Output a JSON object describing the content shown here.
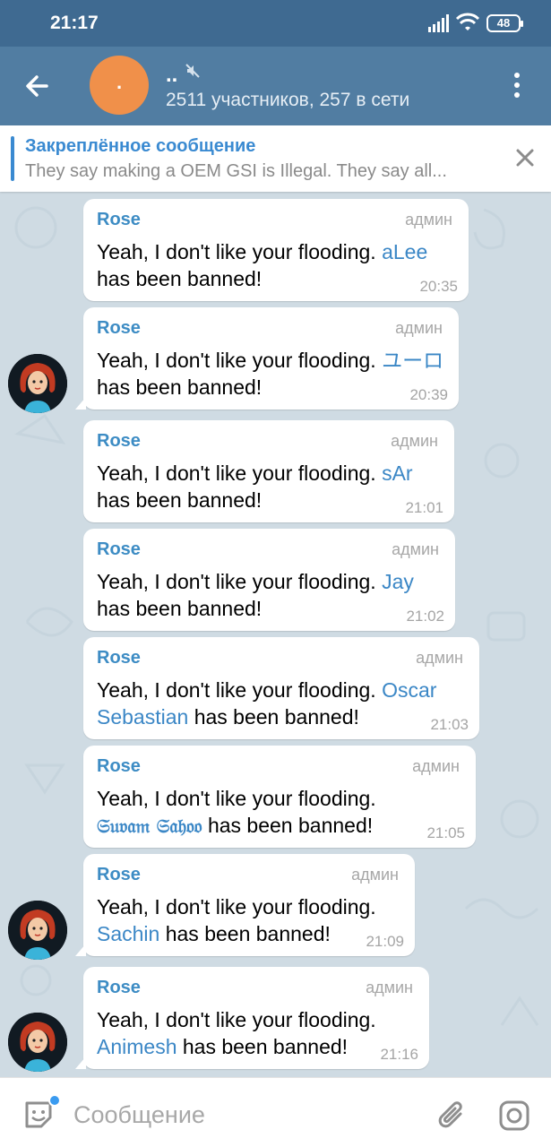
{
  "status_bar": {
    "time": "21:17",
    "battery": "48"
  },
  "header": {
    "avatar_initial": ".",
    "title": "..",
    "subtitle": "2511 участников, 257 в сети",
    "back_icon": "arrow-left-icon",
    "menu_icon": "more-vertical-icon"
  },
  "pinned": {
    "title": "Закреплённое сообщение",
    "text": "They say making a OEM GSI is Illegal. They say all..."
  },
  "messages": [
    {
      "sender": "Rose",
      "role": "админ",
      "text": "Yeah, I don't like your flooding.",
      "mention": "aLee",
      "suffix": "has been banned!",
      "time": "20:35"
    },
    {
      "sender": "Rose",
      "role": "админ",
      "text": "Yeah, I don't like your flooding.",
      "mention": "ユーロ",
      "suffix": "has been banned!",
      "time": "20:39"
    },
    {
      "sender": "Rose",
      "role": "админ",
      "text": "Yeah, I don't like your flooding.",
      "mention": "sAr",
      "suffix": "has been banned!",
      "time": "21:01"
    },
    {
      "sender": "Rose",
      "role": "админ",
      "text": "Yeah, I don't like your flooding.",
      "mention": "Jay",
      "suffix": "has been banned!",
      "time": "21:02"
    },
    {
      "sender": "Rose",
      "role": "админ",
      "text": "Yeah, I don't like your flooding.",
      "mention": "Oscar Sebastian",
      "suffix": "has been banned!",
      "time": "21:03"
    },
    {
      "sender": "Rose",
      "role": "админ",
      "text": "Yeah, I don't like your flooding.",
      "mention": "𝔖𝔲𝔳𝔞𝔪 𝔖𝔞𝔥𝔬𝔬",
      "suffix": "has been banned!",
      "time": "21:05"
    },
    {
      "sender": "Rose",
      "role": "админ",
      "text": "Yeah, I don't like your flooding.",
      "mention": "Sachin",
      "suffix": "has been banned!",
      "time": "21:09"
    },
    {
      "sender": "Rose",
      "role": "админ",
      "text": "Yeah, I don't like your flooding.",
      "mention": "Animesh",
      "suffix": "has been banned!",
      "time": "21:16"
    }
  ],
  "input": {
    "placeholder": "Сообщение"
  },
  "colors": {
    "header": "#517da2",
    "status_bar": "#3f6a91",
    "accent": "#3d8cc4",
    "chat_bg": "#cfdbe3",
    "avatar": "#f0904a"
  }
}
